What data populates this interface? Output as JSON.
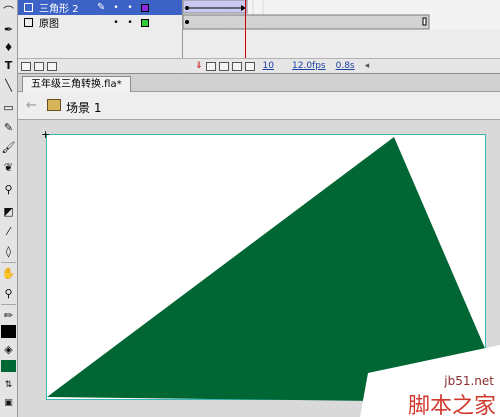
{
  "timeline": {
    "layers": [
      {
        "name": "三角形 2",
        "selected": true,
        "color": "#8a2be2"
      },
      {
        "name": "原图",
        "selected": false,
        "color": "#33cc33"
      }
    ],
    "footer": {
      "frame": "10",
      "fps": "12.0fps",
      "time": "0.8s"
    }
  },
  "document": {
    "tab_title": "五年级三角转换.fla*"
  },
  "scene": {
    "label": "场景 1"
  },
  "stage": {
    "shape_color": "#006633",
    "border_color": "#3ab7b7"
  },
  "watermark": {
    "url": "jb51.net",
    "text": "脚本之家"
  }
}
